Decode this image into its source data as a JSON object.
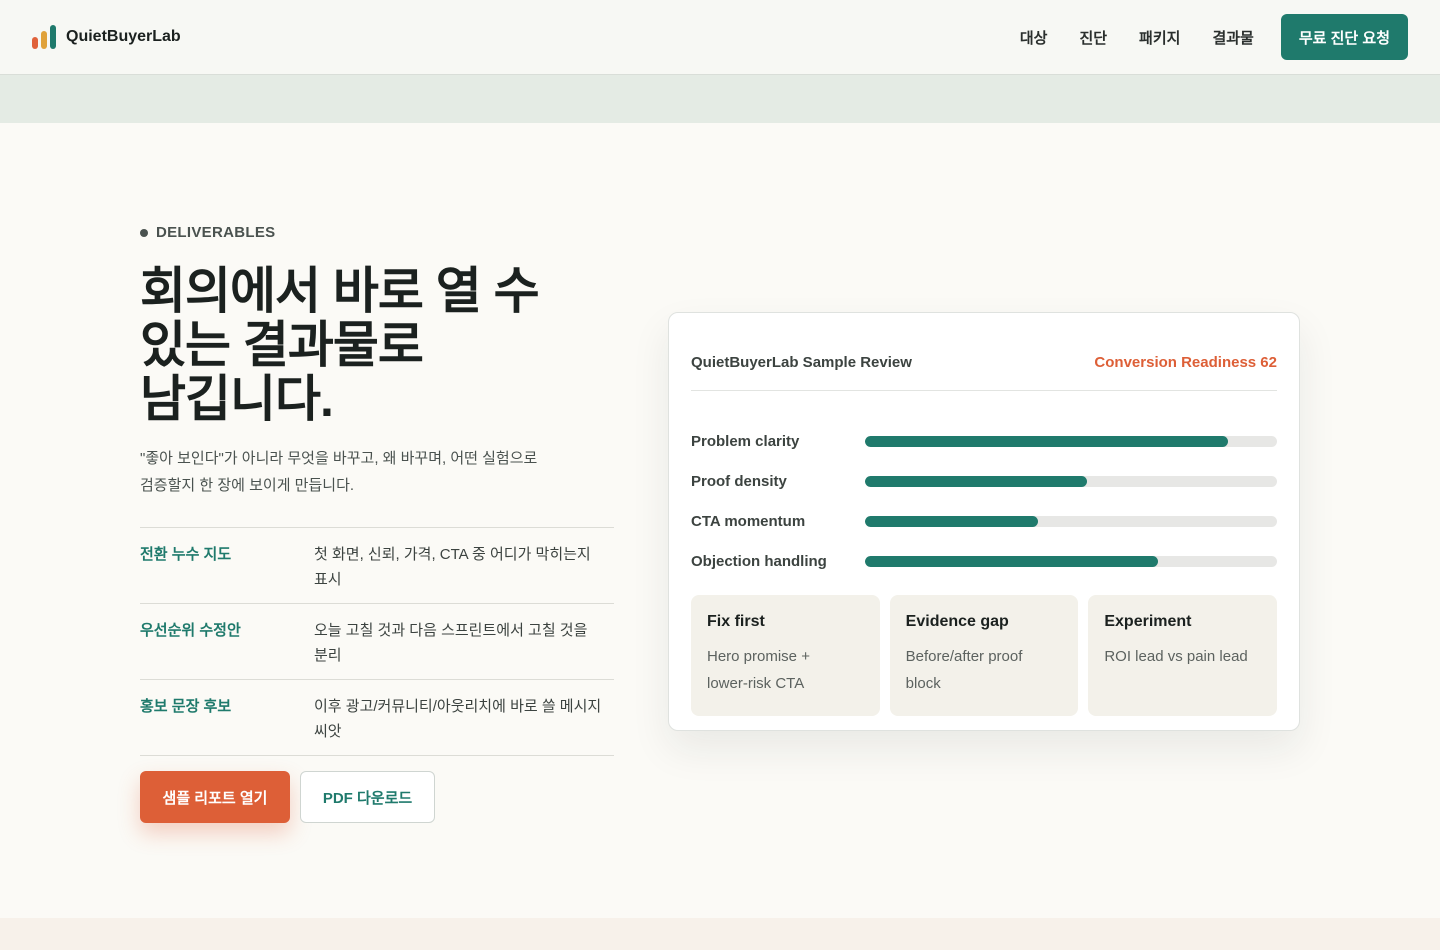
{
  "brand": {
    "name": "QuietBuyerLab"
  },
  "nav": {
    "items": [
      "대상",
      "진단",
      "패키지",
      "결과물"
    ],
    "cta": "무료 진단 요청"
  },
  "hero": {
    "eyebrow": "DELIVERABLES",
    "headline_lines": [
      "회의에서 바로 열 수",
      "있는 결과물로",
      "남깁니다."
    ],
    "lede_lines": [
      "\"좋아 보인다\"가 아니라 무엇을 바꾸고, 왜 바꾸며, 어떤 실험으로",
      "검증할지 한 장에 보이게 만듭니다."
    ],
    "features": [
      {
        "key": "전환 누수 지도",
        "value_lines": [
          "첫 화면, 신뢰, 가격, CTA 중 어디가 막히는지",
          "표시"
        ]
      },
      {
        "key": "우선순위 수정안",
        "value_lines": [
          "오늘 고칠 것과 다음 스프린트에서 고칠 것을",
          "분리"
        ]
      },
      {
        "key": "홍보 문장 후보",
        "value_lines": [
          "이후 광고/커뮤니티/아웃리치에 바로 쓸 메시지",
          "씨앗"
        ]
      }
    ],
    "primary_button": "샘플 리포트 열기",
    "secondary_button": "PDF 다운로드"
  },
  "card": {
    "title": "QuietBuyerLab Sample Review",
    "score": "Conversion Readiness 62",
    "metrics": [
      {
        "label": "Problem clarity",
        "fill": 0.88
      },
      {
        "label": "Proof density",
        "fill": 0.54
      },
      {
        "label": "CTA momentum",
        "fill": 0.42
      },
      {
        "label": "Objection handling",
        "fill": 0.71
      }
    ],
    "tiles": [
      {
        "title": "Fix first",
        "lines": [
          "Hero promise +",
          "lower-risk CTA"
        ]
      },
      {
        "title": "Evidence gap",
        "lines": [
          "Before/after proof",
          "block"
        ]
      },
      {
        "title": "Experiment",
        "lines": [
          "ROI lead vs pain lead"
        ]
      }
    ]
  },
  "colors": {
    "accent": "#1f7a6c",
    "cta": "#dd5f37",
    "logo_bars": [
      "#e0623a",
      "#e0a23a",
      "#1f7a6c"
    ]
  }
}
